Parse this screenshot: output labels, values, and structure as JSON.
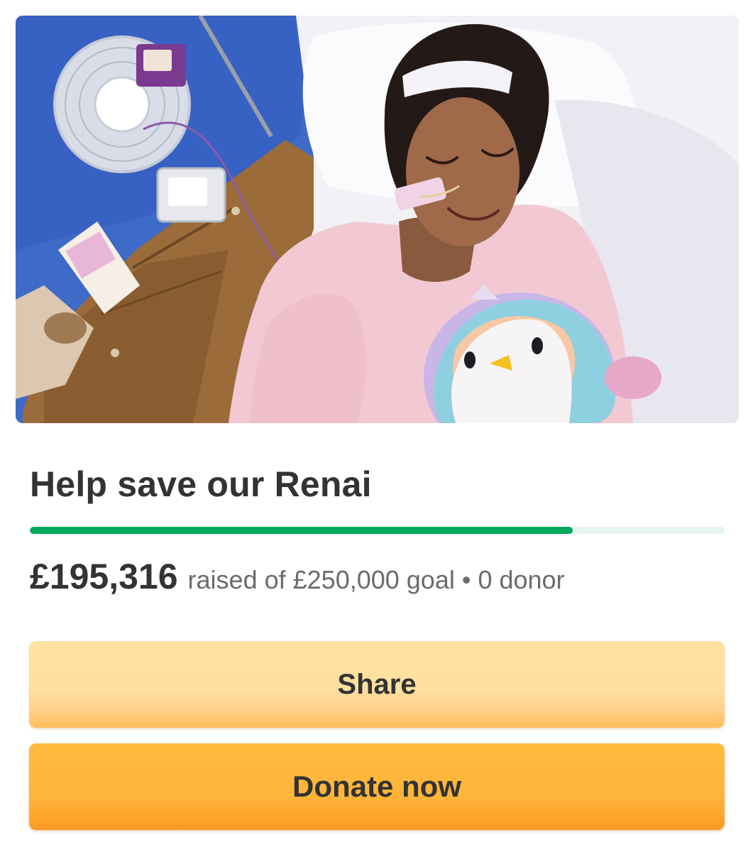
{
  "campaign": {
    "title": "Help save our Renai",
    "raised": "£195,316",
    "raised_meta": "raised of £250,000 goal • 0 donor",
    "progress_fraction": 0.781
  },
  "actions": {
    "share_label": "Share",
    "donate_label": "Donate now"
  },
  "colors": {
    "progress": "#02a95c",
    "progress_track": "#e6f4ee",
    "share_button": "#ffe0a0",
    "donate_button": "#ffb53a",
    "text": "#333333",
    "muted_text": "#6b6b6b"
  }
}
